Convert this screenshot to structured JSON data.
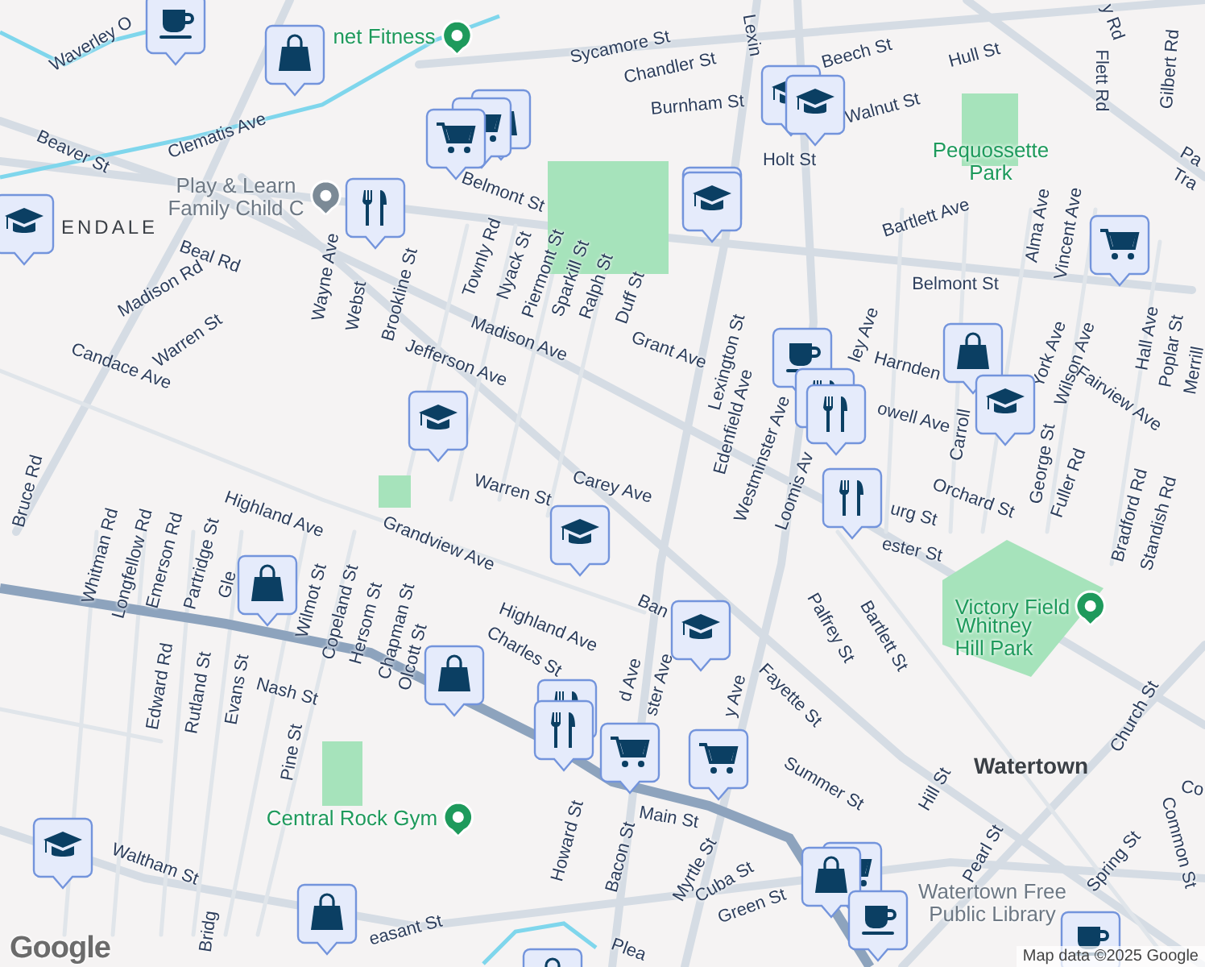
{
  "map": {
    "street_labels": [
      "Waverley O",
      "Sycamore St",
      "Chandler St",
      "Lexin",
      "Beech St",
      "Hull St",
      "Burnham St",
      "Walnut St",
      "Flett Rd",
      "Gilbert Rd",
      "y Rd",
      "Beaver St",
      "Clematis Ave",
      "Holt St",
      "Bartlett Ave",
      "Belmont St",
      "Belmont St",
      "Beal Rd",
      "Madison Rd",
      "Wayne Ave",
      "Webst",
      "Brookline St",
      "Townly Rd",
      "Nyack St",
      "Piermont St",
      "Sparkill St",
      "Ralph St",
      "Duff St",
      "Alma Ave",
      "Vincent Ave",
      "Hall Ave",
      "Poplar St",
      "Merrill",
      "Warren St",
      "Candace Ave",
      "Jefferson Ave",
      "Madison Ave",
      "Grant Ave",
      "Lexington St",
      "Edenfield Ave",
      "Westminster Ave",
      "Loomis Av",
      "ley Ave",
      "Harnden",
      "York Ave",
      "Wilson Ave",
      "Fairview Ave",
      "owell Ave",
      "Carroll",
      "George St",
      "Fuller Rd",
      "Orchard St",
      "urg St",
      "ester St",
      "Bradford Rd",
      "Standish Rd",
      "Bruce Rd",
      "Whitman Rd",
      "Longfellow Rd",
      "Emerson Rd",
      "Partridge St",
      "Gle",
      "Wilmot St",
      "Copeland St",
      "Hersom St",
      "Chapman St",
      "Olcott St",
      "Highland Ave",
      "Grandview Ave",
      "Highland Ave",
      "Charles St",
      "Warren St",
      "Carey Ave",
      "Howard St",
      "Bacon St",
      "Edward Rd",
      "Rutland St",
      "Evans St",
      "Nash St",
      "Pine St",
      "Waltham St",
      "easant St",
      "Bridg",
      "Palfrey St",
      "Bartlett St",
      "Fayette St",
      "Summer St",
      "Main St",
      "Myrtle St",
      "Cuba St",
      "Green St",
      "Hill St",
      "Pearl St",
      "Spring St",
      "Common St",
      "Church St",
      "Ban",
      "Plea",
      "ster Ave",
      "d Ave",
      "y Ave",
      "Tra",
      "Pa",
      "Co"
    ],
    "area_labels": [
      "ENDALE",
      "Watertown"
    ],
    "places": [
      {
        "name": "net Fitness",
        "kind": "recreation",
        "pin": true
      },
      {
        "name": "Play & Learn\nFamily Child C",
        "kind": "facility",
        "pin": true
      },
      {
        "name": "Pequossette\nPark",
        "kind": "recreation",
        "pin": false
      },
      {
        "name": "Victory Field",
        "kind": "recreation",
        "pin": true
      },
      {
        "name": "Whitney\nHill Park",
        "kind": "recreation",
        "pin": false
      },
      {
        "name": "Central Rock Gym",
        "kind": "recreation",
        "pin": true
      },
      {
        "name": "Watertown Free\nPublic Library",
        "kind": "facility",
        "pin": false
      }
    ],
    "markers": [
      {
        "layers": [
          {
            "kind": "coffee"
          }
        ]
      },
      {
        "layers": [
          {
            "kind": "shopping"
          }
        ]
      },
      {
        "layers": [
          {
            "kind": "shopping"
          },
          {
            "kind": "cart"
          },
          {
            "kind": "cart"
          }
        ]
      },
      {
        "layers": [
          {
            "kind": "school"
          }
        ]
      },
      {
        "layers": [
          {
            "kind": "restaurant"
          }
        ]
      },
      {
        "layers": [
          {
            "kind": "school"
          }
        ]
      },
      {
        "layers": [
          {
            "kind": "school"
          },
          {
            "kind": "school"
          }
        ]
      },
      {
        "layers": [
          {
            "kind": "school"
          },
          {
            "kind": "school"
          }
        ]
      },
      {
        "layers": [
          {
            "kind": "cart"
          }
        ]
      },
      {
        "layers": [
          {
            "kind": "coffee"
          },
          {
            "kind": "restaurant"
          },
          {
            "kind": "restaurant"
          }
        ]
      },
      {
        "layers": [
          {
            "kind": "shopping"
          },
          {
            "kind": "school"
          }
        ]
      },
      {
        "layers": [
          {
            "kind": "restaurant"
          }
        ]
      },
      {
        "layers": [
          {
            "kind": "school"
          }
        ]
      },
      {
        "layers": [
          {
            "kind": "school"
          }
        ]
      },
      {
        "layers": [
          {
            "kind": "shopping"
          }
        ]
      },
      {
        "layers": [
          {
            "kind": "shopping"
          }
        ]
      },
      {
        "layers": [
          {
            "kind": "restaurant"
          },
          {
            "kind": "restaurant"
          },
          {
            "kind": "cart"
          }
        ]
      },
      {
        "layers": [
          {
            "kind": "cart"
          }
        ]
      },
      {
        "layers": [
          {
            "kind": "school"
          }
        ]
      },
      {
        "layers": [
          {
            "kind": "shopping"
          }
        ]
      },
      {
        "layers": [
          {
            "kind": "cart"
          },
          {
            "kind": "shopping"
          },
          {
            "kind": "coffee"
          }
        ]
      },
      {
        "layers": [
          {
            "kind": "coffee"
          }
        ]
      },
      {
        "layers": [
          {
            "kind": "shopping"
          }
        ]
      }
    ]
  },
  "logo": "Google",
  "attribution": "Map data ©2025 Google"
}
